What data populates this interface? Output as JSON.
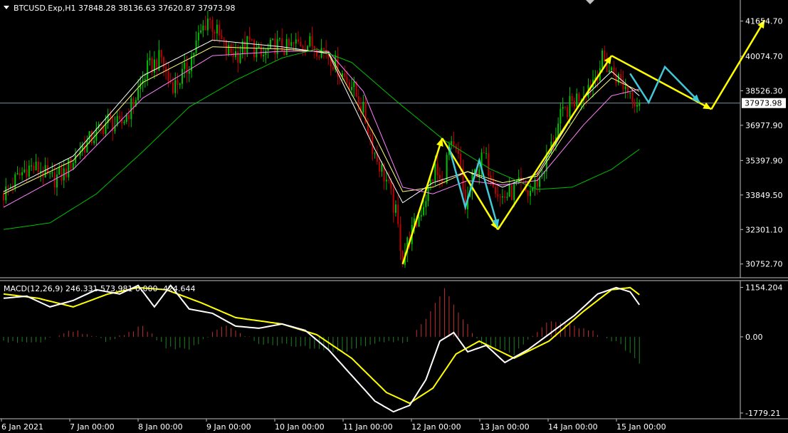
{
  "header": {
    "symbol_line": "BTCUSD.Exp,H1  37848.28 38136.63 37620.87 37973.98",
    "dropdown_icon": "triangle-down-icon"
  },
  "price_axis": {
    "ticks": [
      "41654.70",
      "40074.70",
      "38526.30",
      "36977.90",
      "35397.90",
      "33849.50",
      "32301.10",
      "30752.70"
    ],
    "current_price": "37973.98"
  },
  "macd": {
    "label": "MACD(12,26,9) 246.331 573.981 0.000 -424.644",
    "ticks": [
      "1154.204",
      "0.00",
      "-1779.21"
    ]
  },
  "time_axis": {
    "labels": [
      "6 Jan 2021",
      "7 Jan 00:00",
      "8 Jan 00:00",
      "9 Jan 00:00",
      "10 Jan 00:00",
      "11 Jan 00:00",
      "12 Jan 00:00",
      "13 Jan 00:00",
      "14 Jan 00:00",
      "15 Jan 00:00"
    ]
  },
  "colors": {
    "background": "#000000",
    "frame": "#c0c0c0",
    "text": "#ffffff",
    "bull": "#00c000",
    "bear": "#c00000",
    "ma_fast": "#ffffff",
    "ma_mid": "#ffff80",
    "ma_slow": "#ff80ff",
    "ma_long": "#00c000",
    "arrow_yellow": "#ffff00",
    "arrow_cyan": "#40c8d8",
    "macd_line": "#ffffff",
    "signal_line": "#ffff00",
    "hist_pos": "#c03030",
    "hist_neg": "#208020"
  },
  "chart_data": [
    {
      "type": "candlestick",
      "title": "BTCUSD.Exp,H1",
      "ohlc_last": {
        "open": 37848.28,
        "high": 38136.63,
        "low": 37620.87,
        "close": 37973.98
      },
      "x_ticks": [
        "6 Jan 2021",
        "7 Jan 00:00",
        "8 Jan 00:00",
        "9 Jan 00:00",
        "10 Jan 00:00",
        "11 Jan 00:00",
        "12 Jan 00:00",
        "13 Jan 00:00",
        "14 Jan 00:00",
        "15 Jan 00:00"
      ],
      "y_ticks": [
        41654.7,
        40074.7,
        38526.3,
        36977.9,
        35397.9,
        33849.5,
        32301.1,
        30752.7
      ],
      "ylim": [
        30200,
        42600
      ],
      "current_price": 37973.98,
      "close_path": [
        [
          0,
          33900
        ],
        [
          6,
          34600
        ],
        [
          10,
          35100
        ],
        [
          16,
          35000
        ],
        [
          20,
          34500
        ],
        [
          26,
          34800
        ],
        [
          33,
          35900
        ],
        [
          40,
          36600
        ],
        [
          45,
          37200
        ],
        [
          50,
          36900
        ],
        [
          56,
          38000
        ],
        [
          62,
          39500
        ],
        [
          68,
          40000
        ],
        [
          71,
          39000
        ],
        [
          74,
          38800
        ],
        [
          79,
          39500
        ],
        [
          84,
          40900
        ],
        [
          88,
          41800
        ],
        [
          91,
          41300
        ],
        [
          96,
          40300
        ],
        [
          101,
          40200
        ],
        [
          106,
          40700
        ],
        [
          111,
          40000
        ],
        [
          117,
          40600
        ],
        [
          122,
          40400
        ],
        [
          128,
          40700
        ],
        [
          133,
          40600
        ],
        [
          139,
          40300
        ],
        [
          145,
          39400
        ],
        [
          150,
          38800
        ],
        [
          155,
          37600
        ],
        [
          160,
          35700
        ],
        [
          165,
          34500
        ],
        [
          169,
          33000
        ],
        [
          172,
          31000
        ],
        [
          175,
          32000
        ],
        [
          178,
          32600
        ],
        [
          182,
          33800
        ],
        [
          186,
          35000
        ],
        [
          189,
          34200
        ],
        [
          192,
          36000
        ],
        [
          196,
          35500
        ],
        [
          199,
          33300
        ],
        [
          203,
          34800
        ],
        [
          207,
          35600
        ],
        [
          211,
          34600
        ],
        [
          214,
          33700
        ],
        [
          218,
          33900
        ],
        [
          222,
          34200
        ],
        [
          226,
          33900
        ],
        [
          231,
          34600
        ],
        [
          236,
          36000
        ],
        [
          240,
          37300
        ],
        [
          245,
          38000
        ],
        [
          250,
          38500
        ],
        [
          255,
          39200
        ],
        [
          258,
          39900
        ],
        [
          261,
          39500
        ],
        [
          264,
          39200
        ],
        [
          267,
          38800
        ],
        [
          270,
          38500
        ],
        [
          272,
          38200
        ],
        [
          274,
          37974
        ]
      ],
      "moving_averages": [
        {
          "id": "fast",
          "color": "#ffffff",
          "points": [
            [
              0,
              34000
            ],
            [
              30,
              35600
            ],
            [
              60,
              39200
            ],
            [
              90,
              40800
            ],
            [
              120,
              40500
            ],
            [
              140,
              40200
            ],
            [
              160,
              35900
            ],
            [
              172,
              33500
            ],
            [
              185,
              34400
            ],
            [
              200,
              34900
            ],
            [
              215,
              34200
            ],
            [
              230,
              34800
            ],
            [
              250,
              38200
            ],
            [
              262,
              39400
            ],
            [
              274,
              38300
            ]
          ]
        },
        {
          "id": "mid",
          "color": "#ffff80",
          "points": [
            [
              0,
              33900
            ],
            [
              30,
              35400
            ],
            [
              60,
              38900
            ],
            [
              90,
              40500
            ],
            [
              120,
              40400
            ],
            [
              140,
              40250
            ],
            [
              160,
              36500
            ],
            [
              172,
              34000
            ],
            [
              185,
              34200
            ],
            [
              200,
              34900
            ],
            [
              215,
              34400
            ],
            [
              230,
              34700
            ],
            [
              250,
              37900
            ],
            [
              262,
              39100
            ],
            [
              274,
              38500
            ]
          ]
        },
        {
          "id": "slow",
          "color": "#ff80ff",
          "points": [
            [
              0,
              33300
            ],
            [
              30,
              35000
            ],
            [
              60,
              38200
            ],
            [
              90,
              40100
            ],
            [
              120,
              40300
            ],
            [
              140,
              40300
            ],
            [
              155,
              38500
            ],
            [
              172,
              34200
            ],
            [
              185,
              33900
            ],
            [
              200,
              34500
            ],
            [
              215,
              34300
            ],
            [
              230,
              34500
            ],
            [
              250,
              37000
            ],
            [
              262,
              38300
            ],
            [
              274,
              38600
            ]
          ]
        },
        {
          "id": "long",
          "color": "#00c000",
          "points": [
            [
              0,
              32300
            ],
            [
              20,
              32600
            ],
            [
              40,
              33900
            ],
            [
              60,
              35800
            ],
            [
              80,
              37800
            ],
            [
              100,
              39000
            ],
            [
              120,
              40000
            ],
            [
              135,
              40400
            ],
            [
              150,
              39800
            ],
            [
              170,
              38000
            ],
            [
              190,
              36300
            ],
            [
              210,
              35000
            ],
            [
              230,
              34100
            ],
            [
              245,
              34200
            ],
            [
              262,
              35000
            ],
            [
              274,
              35900
            ]
          ]
        }
      ],
      "annotations": [
        {
          "type": "polyline",
          "color": "#ffff00",
          "points": [
            [
              172,
              30750
            ],
            [
              189,
              36400
            ]
          ]
        },
        {
          "type": "polyline",
          "color": "#ffff00",
          "points": [
            [
              189,
              36400
            ],
            [
              213,
              32300
            ]
          ]
        },
        {
          "type": "polyline",
          "color": "#ffff00",
          "points": [
            [
              213,
              32300
            ],
            [
              262,
              40100
            ]
          ]
        },
        {
          "type": "polyline",
          "color": "#ffff00",
          "points": [
            [
              262,
              40100
            ],
            [
              305,
              37700
            ]
          ]
        },
        {
          "type": "polyline",
          "color": "#ffff00",
          "points": [
            [
              305,
              37700
            ],
            [
              328,
              41700
            ]
          ]
        },
        {
          "type": "polyline",
          "color": "#40c8d8",
          "points": [
            [
              192,
              36000
            ],
            [
              199,
              33300
            ],
            [
              205,
              35400
            ],
            [
              213,
              32400
            ]
          ]
        },
        {
          "type": "polyline",
          "color": "#40c8d8",
          "points": [
            [
              270,
              39300
            ],
            [
              278,
              38000
            ],
            [
              285,
              39600
            ],
            [
              300,
              38000
            ]
          ]
        }
      ]
    },
    {
      "type": "macd",
      "title": "MACD(12,26,9)",
      "values_label": [
        246.331,
        573.981,
        0.0,
        -424.644
      ],
      "y_ticks": [
        1154.204,
        0.0,
        -1779.21
      ],
      "ylim": [
        -1880,
        1280
      ],
      "macd_line": [
        [
          0,
          900
        ],
        [
          10,
          950
        ],
        [
          20,
          700
        ],
        [
          30,
          850
        ],
        [
          40,
          1100
        ],
        [
          50,
          1000
        ],
        [
          58,
          1200
        ],
        [
          65,
          700
        ],
        [
          72,
          1200
        ],
        [
          80,
          650
        ],
        [
          90,
          550
        ],
        [
          100,
          250
        ],
        [
          110,
          200
        ],
        [
          120,
          300
        ],
        [
          130,
          150
        ],
        [
          140,
          -300
        ],
        [
          150,
          -900
        ],
        [
          160,
          -1500
        ],
        [
          168,
          -1750
        ],
        [
          175,
          -1600
        ],
        [
          182,
          -1000
        ],
        [
          188,
          -100
        ],
        [
          194,
          100
        ],
        [
          200,
          -350
        ],
        [
          208,
          -200
        ],
        [
          216,
          -600
        ],
        [
          226,
          -300
        ],
        [
          236,
          100
        ],
        [
          246,
          500
        ],
        [
          256,
          1000
        ],
        [
          264,
          1150
        ],
        [
          270,
          1050
        ],
        [
          276,
          600
        ]
      ],
      "signal_line": [
        [
          0,
          1000
        ],
        [
          15,
          900
        ],
        [
          30,
          700
        ],
        [
          45,
          1000
        ],
        [
          58,
          1150
        ],
        [
          70,
          1100
        ],
        [
          85,
          800
        ],
        [
          100,
          450
        ],
        [
          120,
          300
        ],
        [
          135,
          50
        ],
        [
          150,
          -500
        ],
        [
          165,
          -1300
        ],
        [
          175,
          -1550
        ],
        [
          185,
          -1200
        ],
        [
          195,
          -400
        ],
        [
          205,
          -100
        ],
        [
          220,
          -500
        ],
        [
          235,
          -100
        ],
        [
          250,
          600
        ],
        [
          262,
          1100
        ],
        [
          270,
          1150
        ],
        [
          276,
          900
        ]
      ],
      "histogram": [
        [
          0,
          -100
        ],
        [
          15,
          -150
        ],
        [
          30,
          150
        ],
        [
          45,
          -100
        ],
        [
          60,
          250
        ],
        [
          70,
          -250
        ],
        [
          80,
          -300
        ],
        [
          95,
          300
        ],
        [
          110,
          -150
        ],
        [
          125,
          -200
        ],
        [
          145,
          -350
        ],
        [
          160,
          -150
        ],
        [
          175,
          -100
        ],
        [
          190,
          1100
        ],
        [
          205,
          -150
        ],
        [
          220,
          -400
        ],
        [
          235,
          400
        ],
        [
          250,
          200
        ],
        [
          265,
          -150
        ],
        [
          276,
          -700
        ]
      ]
    }
  ]
}
